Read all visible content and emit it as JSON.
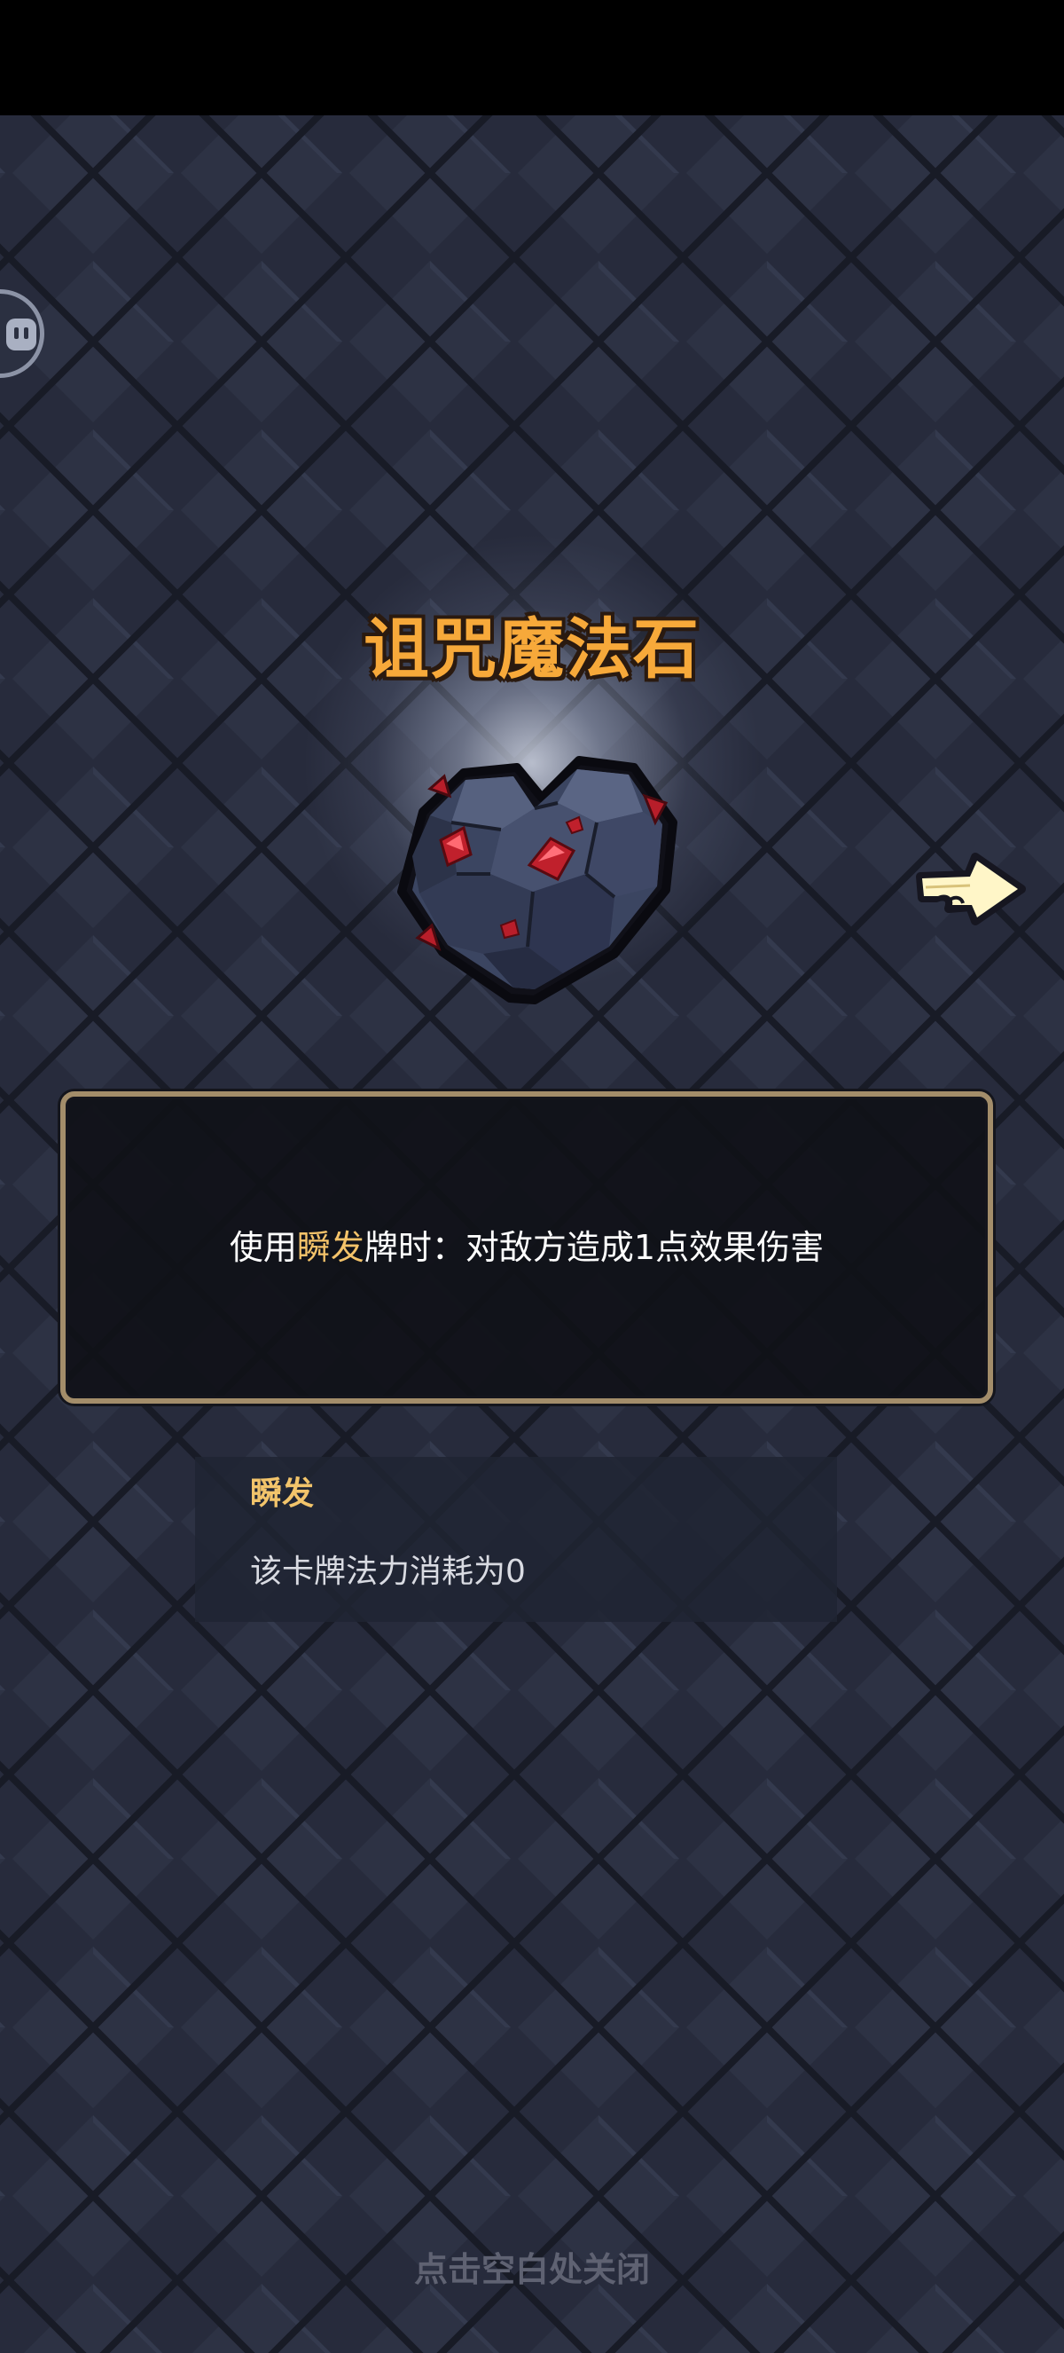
{
  "item": {
    "title": "诅咒魔法石",
    "art_icon": "cursed-heart-stone-icon",
    "description": {
      "prefix": "使用",
      "keyword": "瞬发",
      "suffix": "牌时：对敌方造成1点效果伤害"
    }
  },
  "keyword_panel": {
    "name": "瞬发",
    "description": "该卡牌法力消耗为0"
  },
  "footer": {
    "close_hint": "点击空白处关闭"
  },
  "colors": {
    "background": "#262a3b",
    "title": "#f7a93a",
    "keyword": "#f4c36a",
    "box_border": "#a38d6a",
    "hint": "#5f6272"
  },
  "icons": {
    "next": "pointing-hand-arrow-icon",
    "float_ball": "assistant-ball-icon"
  }
}
